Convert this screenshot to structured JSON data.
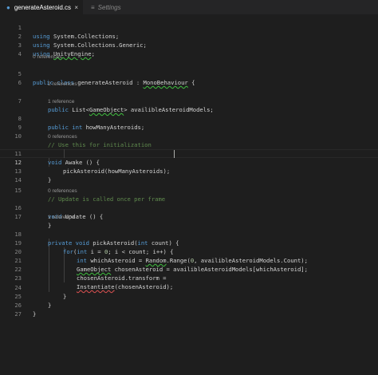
{
  "tabs": [
    {
      "label": "generateAsteroid.cs",
      "icon": "csharp-file-icon",
      "active": true,
      "close": "×"
    },
    {
      "label": "Settings",
      "icon": "settings-file-icon",
      "active": false
    }
  ],
  "editor": {
    "cursor_line": 12,
    "lens": {
      "l5": "0 references",
      "l7": "2 references",
      "l8": "1 reference",
      "l11": "0 references",
      "l16": "0 references",
      "l18": "1 reference"
    },
    "line_numbers": [
      "1",
      "2",
      "3",
      "4",
      "5",
      "6",
      "7",
      "8",
      "9",
      "10",
      "11",
      "12",
      "13",
      "14",
      "15",
      "16",
      "17",
      "18",
      "19",
      "20",
      "21",
      "22",
      "23",
      "24",
      "25",
      "26",
      "27"
    ],
    "code": {
      "l1": {
        "kw": "using ",
        "rest": "System.Collections;"
      },
      "l2": {
        "kw": "using ",
        "rest": "System.Collections.Generic;"
      },
      "l3": {
        "kw": "using ",
        "squig": "UnityEngine",
        "rest": ";"
      },
      "l5": {
        "kw": "public class ",
        "name": "generateAsteroid",
        "sep": " : ",
        "squig": "MonoBehaviour",
        "rest": " {"
      },
      "l7": {
        "kw": "public ",
        "a": "List<",
        "squig": "GameObject",
        "b": "> availibleAsteroidModels;"
      },
      "l8": {
        "kw": "public int ",
        "rest": "howManyAsteroids;"
      },
      "l10": {
        "comment": "// Use this for initialization"
      },
      "l11": {
        "kw": "void ",
        "rest": "Awake () {"
      },
      "l12": {
        "rest": "pickAsteroid(howManyAsteroids);"
      },
      "l13": {
        "rest": "}"
      },
      "l15": {
        "comment": "// Update is called once per frame"
      },
      "l16": {
        "kw": "void ",
        "rest": "Update () {"
      },
      "l17": {
        "rest": "}"
      },
      "l18": {
        "kw": "private void ",
        "a": "pickAsteroid(",
        "kw2": "int ",
        "b": "count) {"
      },
      "l19": {
        "kw": "for",
        "a": "(",
        "kw2": "int ",
        "b": "i = ",
        "n1": "0",
        "c": "; i < count; i++) {"
      },
      "l20": {
        "kw": "int ",
        "a": "whichAsteroid = ",
        "squig": "Random",
        "b": ".Range(",
        "n1": "0",
        "c": ", availibleAsteroidModels.Count);"
      },
      "l21": {
        "squig": "GameObject",
        "rest": " chosenAsteroid = availibleAsteroidModels[whichAsteroid];"
      },
      "l22": {
        "rest": "chosenAsteroid.transform ="
      },
      "l23": {
        "squig": "Instantiate",
        "rest": "(chosenAsteroid);"
      },
      "l24": {
        "rest": "}"
      },
      "l25": {
        "rest": "}"
      },
      "l26": {
        "rest": "}"
      }
    }
  }
}
